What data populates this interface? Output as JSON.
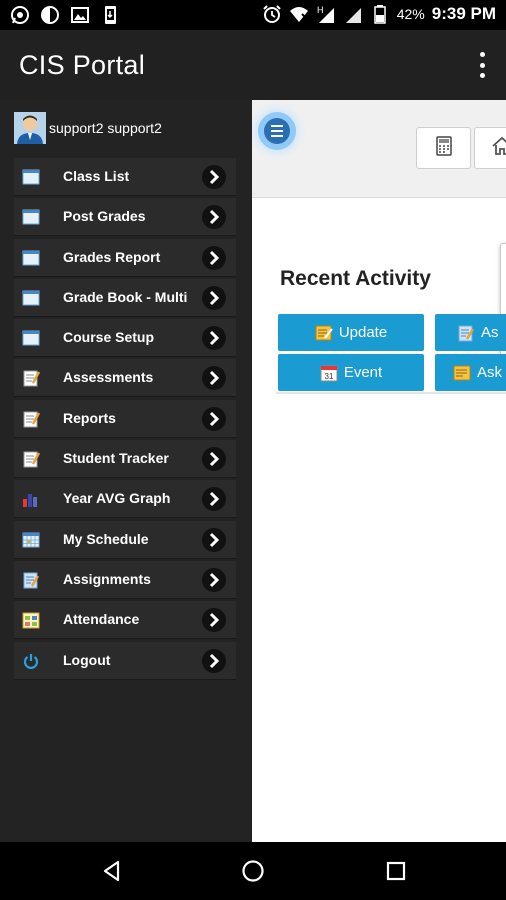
{
  "status_bar": {
    "battery": "42%",
    "time": "9:39 PM",
    "icons": [
      "whatsapp-icon",
      "contrast-icon",
      "gallery-icon",
      "phone-sync-icon",
      "alarm-icon",
      "wifi-icon",
      "h-network-icon",
      "signal-icon",
      "battery-icon"
    ]
  },
  "app_bar": {
    "title": "CIS Portal",
    "menu_icon": "overflow-menu-icon"
  },
  "drawer": {
    "user_name": "support2 support2",
    "items": [
      {
        "label": "Class List",
        "icon": "window-icon"
      },
      {
        "label": "Post Grades",
        "icon": "window-icon"
      },
      {
        "label": "Grades Report",
        "icon": "window-icon"
      },
      {
        "label": "Grade Book - Multi",
        "icon": "window-icon"
      },
      {
        "label": "Course Setup",
        "icon": "window-icon"
      },
      {
        "label": "Assessments",
        "icon": "notepad-icon"
      },
      {
        "label": "Reports",
        "icon": "notepad-icon"
      },
      {
        "label": "Student Tracker",
        "icon": "notepad-icon"
      },
      {
        "label": "Year AVG Graph",
        "icon": "bar-chart-icon"
      },
      {
        "label": "My Schedule",
        "icon": "calendar-grid-icon"
      },
      {
        "label": "Assignments",
        "icon": "assignment-icon"
      },
      {
        "label": "Attendance",
        "icon": "attendance-icon"
      },
      {
        "label": "Logout",
        "icon": "power-icon"
      }
    ]
  },
  "content": {
    "heading": "Recent Activity",
    "buttons": [
      {
        "label": "Update",
        "icon": "edit-note-icon"
      },
      {
        "label": "As",
        "icon": "assignment-icon"
      },
      {
        "label": "Event",
        "icon": "calendar-icon",
        "calendar_day": "31"
      },
      {
        "label": "Ask",
        "icon": "question-icon"
      }
    ],
    "toolbar_icons": [
      "calculator-icon",
      "home-icon"
    ]
  },
  "colors": {
    "app_bar": "#212121",
    "drawer": "#232323",
    "accent_button": "#1a9bd1",
    "fab": "#2b6fb3"
  }
}
